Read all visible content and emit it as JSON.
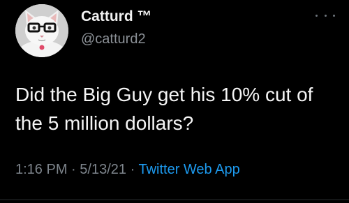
{
  "author": {
    "display_name": "Catturd ™",
    "handle": "@catturd2",
    "avatar_icon": "cat-with-glasses-avatar"
  },
  "menu": {
    "icon": "more-options-icon"
  },
  "tweet": {
    "text": "Did the Big Guy get his 10% cut of the 5 million dollars?",
    "time": "1:16 PM",
    "separator": "·",
    "date": "5/13/21",
    "source": "Twitter Web App"
  },
  "colors": {
    "background": "#000000",
    "text": "#f5f5f5",
    "secondary_text": "#7d848b",
    "link": "#1d9bf0"
  }
}
